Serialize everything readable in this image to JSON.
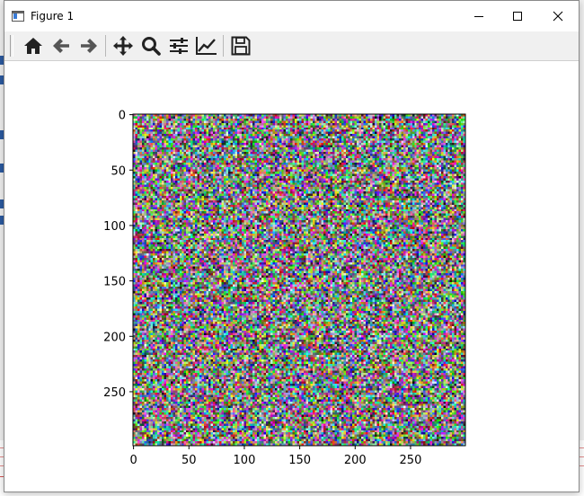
{
  "window": {
    "title": "Figure 1",
    "minimize_icon": "minimize-icon",
    "maximize_icon": "maximize-icon",
    "close_icon": "close-icon"
  },
  "toolbar": {
    "buttons": [
      {
        "icon": "home-icon",
        "tooltip": ""
      },
      {
        "icon": "arrow-left-icon",
        "tooltip": ""
      },
      {
        "icon": "arrow-right-icon",
        "tooltip": ""
      },
      {
        "icon": "pan-icon",
        "tooltip": ""
      },
      {
        "icon": "zoom-icon",
        "tooltip": ""
      },
      {
        "icon": "subplots-icon",
        "tooltip": ""
      },
      {
        "icon": "edit-axis-icon",
        "tooltip": ""
      },
      {
        "icon": "save-icon",
        "tooltip": ""
      }
    ]
  },
  "chart_data": {
    "type": "heatmap",
    "title": "",
    "xlabel": "",
    "ylabel": "",
    "image_size": [
      300,
      300
    ],
    "content": "random RGB noise",
    "xlim": [
      0,
      299
    ],
    "ylim": [
      299,
      0
    ],
    "xticks": [
      0,
      50,
      100,
      150,
      200,
      250
    ],
    "yticks": [
      0,
      50,
      100,
      150,
      200,
      250
    ],
    "xtick_labels": [
      "0",
      "50",
      "100",
      "150",
      "200",
      "250"
    ],
    "ytick_labels": [
      "0",
      "50",
      "100",
      "150",
      "200",
      "250"
    ],
    "grid": false,
    "legend": "none"
  },
  "colors": {
    "titlebar": "#ffffff",
    "toolbar": "#f0f0f0",
    "canvas": "#ffffff",
    "axes_edge": "#000000"
  }
}
